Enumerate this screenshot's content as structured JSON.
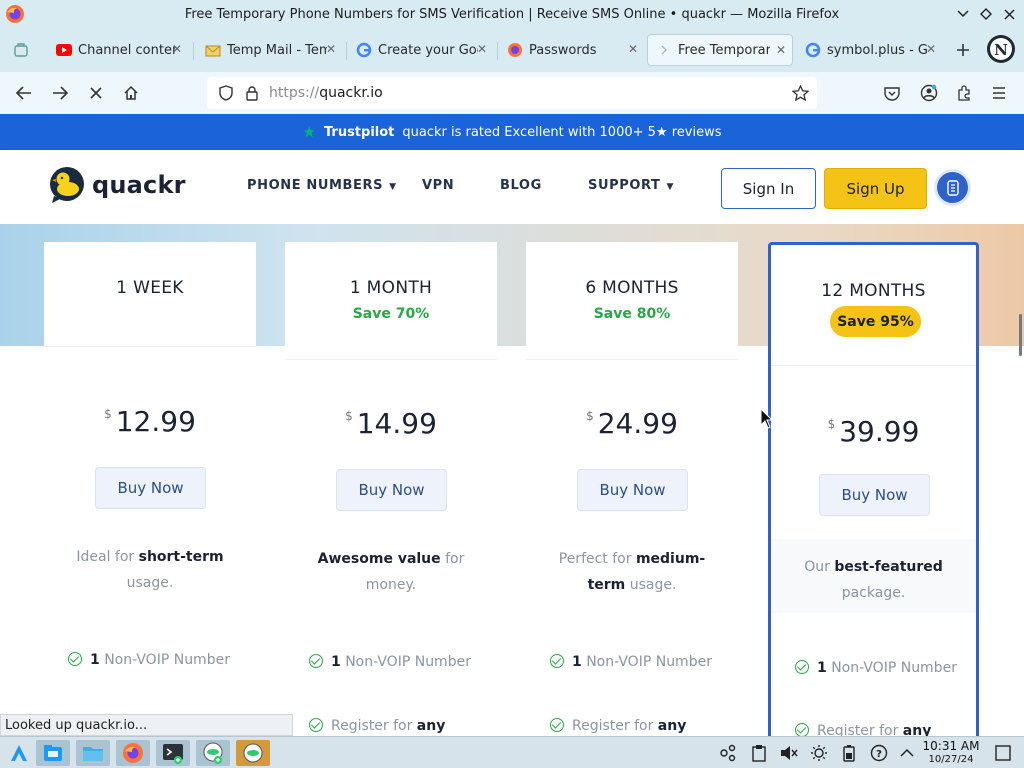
{
  "window": {
    "title": "Free Temporary Phone Numbers for SMS Verification | Receive SMS Online • quackr — Mozilla Firefox"
  },
  "tabs": [
    {
      "label": "Channel content",
      "icon": "youtube-icon",
      "color": "#ff0000"
    },
    {
      "label": "Temp Mail - Temporary",
      "icon": "tempmail-icon",
      "color": "#e8b84a"
    },
    {
      "label": "Create your Google",
      "icon": "google-icon",
      "color": "#4285f4"
    },
    {
      "label": "Passwords",
      "icon": "firefox-icon",
      "color": "#ff7139"
    },
    {
      "label": "Free Temporary Phone",
      "icon": "quackr-icon",
      "color": "#e6f7ff",
      "active": true
    },
    {
      "label": "symbol.plus - Google",
      "icon": "google-icon",
      "color": "#4285f4"
    }
  ],
  "urlbar": {
    "scheme": "https://",
    "host": "quackr.io"
  },
  "trustbar": {
    "brand": "Trustpilot",
    "text": "quackr is rated Excellent with 1000+ 5★ reviews"
  },
  "header": {
    "logo_text": "quackr",
    "nav": [
      {
        "label": "PHONE NUMBERS",
        "has_dropdown": true
      },
      {
        "label": "VPN",
        "has_dropdown": false
      },
      {
        "label": "BLOG",
        "has_dropdown": false
      },
      {
        "label": "SUPPORT",
        "has_dropdown": true
      }
    ],
    "signin": "Sign In",
    "signup": "Sign Up"
  },
  "plans": [
    {
      "name": "1 WEEK",
      "save": "",
      "currency": "$",
      "price": "12.99",
      "buy": "Buy Now",
      "desc_pre": "Ideal for ",
      "desc_bold": "short-term",
      "desc_post": " usage.",
      "features": [
        {
          "bold": "1",
          "text": " Non-VOIP Number"
        },
        {
          "text": "Register for ",
          "bold2": "any"
        }
      ]
    },
    {
      "name": "1 MONTH",
      "save": "Save 70%",
      "currency": "$",
      "price": "14.99",
      "buy": "Buy Now",
      "desc_pre": "",
      "desc_bold": "Awesome value",
      "desc_post": " for money.",
      "features": [
        {
          "bold": "1",
          "text": " Non-VOIP Number"
        },
        {
          "text": "Register for ",
          "bold2": "any"
        }
      ]
    },
    {
      "name": "6 MONTHS",
      "save": "Save 80%",
      "currency": "$",
      "price": "24.99",
      "buy": "Buy Now",
      "desc_pre": "Perfect for ",
      "desc_bold": "medium-term",
      "desc_post": " usage.",
      "features": [
        {
          "bold": "1",
          "text": " Non-VOIP Number"
        },
        {
          "text": "Register for ",
          "bold2": "any"
        }
      ]
    },
    {
      "name": "12 MONTHS",
      "save": "Save 95%",
      "currency": "$",
      "price": "39.99",
      "buy": "Buy Now",
      "desc_pre": "Our ",
      "desc_bold": "best-featured",
      "desc_post": " package.",
      "features": [
        {
          "bold": "1",
          "text": " Non-VOIP Number"
        },
        {
          "text": "Register for ",
          "bold2": "any"
        }
      ]
    }
  ],
  "status": "Looked up quackr.io...",
  "taskbar": {
    "time": "10:31 AM",
    "date": "10/27/24"
  },
  "colors": {
    "accent": "#1a63d8",
    "signup": "#f4c316",
    "save_green": "#27a844"
  }
}
